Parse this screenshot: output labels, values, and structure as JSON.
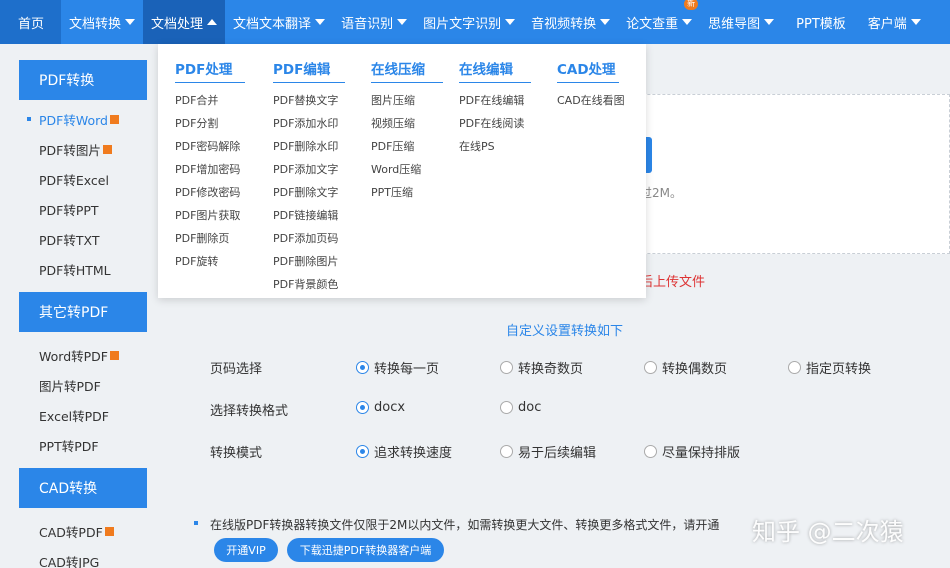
{
  "nav": {
    "home": "首页",
    "items": [
      "文档转换",
      "文档处理",
      "文档文本翻译",
      "语音识别",
      "图片文字识别",
      "音视频转换",
      "论文查重",
      "思维导图",
      "PPT模板",
      "客户端"
    ],
    "new_badge": "新"
  },
  "sidebar": {
    "sections": [
      {
        "title": "PDF转换",
        "items": [
          "PDF转Word",
          "PDF转图片",
          "PDF转Excel",
          "PDF转PPT",
          "PDF转TXT",
          "PDF转HTML"
        ]
      },
      {
        "title": "其它转PDF",
        "items": [
          "Word转PDF",
          "图片转PDF",
          "Excel转PDF",
          "PPT转PDF"
        ]
      },
      {
        "title": "CAD转换",
        "items": [
          "CAD转PDF",
          "CAD转JPG"
        ]
      }
    ]
  },
  "dropdown": {
    "columns": [
      {
        "title": "PDF处理",
        "links": [
          "PDF合并",
          "PDF分割",
          "PDF密码解除",
          "PDF增加密码",
          "PDF修改密码",
          "PDF图片获取",
          "PDF删除页",
          "PDF旋转"
        ]
      },
      {
        "title": "PDF编辑",
        "links": [
          "PDF替换文字",
          "PDF添加水印",
          "PDF删除水印",
          "PDF添加文字",
          "PDF删除文字",
          "PDF链接编辑",
          "PDF添加页码",
          "PDF删除图片",
          "PDF背景颜色"
        ]
      },
      {
        "title": "在线压缩",
        "links": [
          "图片压缩",
          "视频压缩",
          "PDF压缩",
          "Word压缩",
          "PPT压缩"
        ]
      },
      {
        "title": "在线编辑",
        "links": [
          "PDF在线编辑",
          "PDF在线阅读",
          "在线PS"
        ]
      },
      {
        "title": "CAD处理",
        "links": [
          "CAD在线看图"
        ]
      }
    ]
  },
  "upload": {
    "note": "过2M。",
    "tip": "后上传文件"
  },
  "settings": {
    "title": "自定义设置转换如下",
    "rows": [
      {
        "label": "页码选择",
        "options": [
          "转换每一页",
          "转换奇数页",
          "转换偶数页",
          "指定页转换"
        ],
        "selected": 0
      },
      {
        "label": "选择转换格式",
        "options": [
          "docx",
          "doc"
        ],
        "selected": 0
      },
      {
        "label": "转换模式",
        "options": [
          "追求转换速度",
          "易于后续编辑",
          "尽量保持排版"
        ],
        "selected": 0
      }
    ]
  },
  "bottom": {
    "note": "在线版PDF转换器转换文件仅限于2M以内文件，如需转换更大文件、转换更多格式文件，请开通",
    "vip_button": "开通VIP",
    "download_button": "下载迅捷PDF转换器客户端"
  },
  "watermark": "知乎 @二次猿",
  "colors": {
    "primary": "#2b86e8",
    "nav_active": "#1a62b8",
    "badge": "#f07b1e",
    "tip": "#d33333"
  }
}
